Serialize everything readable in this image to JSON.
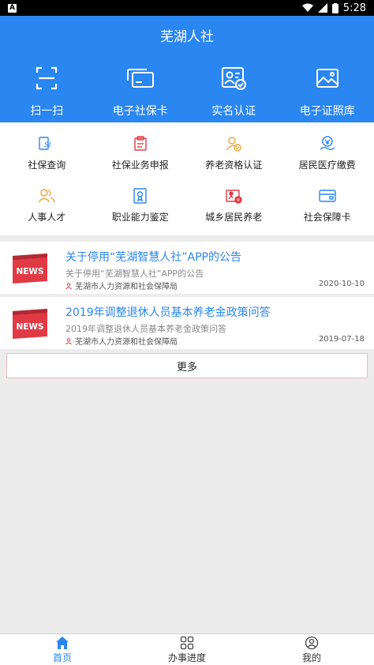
{
  "status_bar": {
    "time": "5:28",
    "notification_letter": "A"
  },
  "header": {
    "title": "芜湖人社",
    "quick_actions": [
      {
        "label": "扫一扫",
        "icon": "scan-icon"
      },
      {
        "label": "电子社保卡",
        "icon": "social-card-icon"
      },
      {
        "label": "实名认证",
        "icon": "id-verify-icon"
      },
      {
        "label": "电子证照库",
        "icon": "photo-license-icon"
      }
    ]
  },
  "services": [
    {
      "label": "社保查询",
      "icon": "si-query-icon"
    },
    {
      "label": "社保业务申报",
      "icon": "business-declare-icon"
    },
    {
      "label": "养老资格认证",
      "icon": "pension-cert-icon"
    },
    {
      "label": "居民医疗缴费",
      "icon": "medical-payment-icon"
    },
    {
      "label": "人事人才",
      "icon": "personnel-icon"
    },
    {
      "label": "职业能力鉴定",
      "icon": "vocational-icon"
    },
    {
      "label": "城乡居民养老",
      "icon": "rural-pension-icon"
    },
    {
      "label": "社会保障卡",
      "icon": "security-card-icon"
    }
  ],
  "news": [
    {
      "badge": "NEWS",
      "title": "关于停用“芜湖智慧人社”APP的公告",
      "summary": "关于停用“芜湖智慧人社”APP的公告",
      "source": "芜湖市人力资源和社会保障局",
      "date": "2020-10-10"
    },
    {
      "badge": "NEWS",
      "title": "2019年调整退休人员基本养老金政策问答",
      "summary": "2019年调整退休人员基本养老金政策问答",
      "source": "芜湖市人力资源和社会保障局",
      "date": "2019-07-18"
    }
  ],
  "more_label": "更多",
  "tabs": [
    {
      "label": "首页",
      "icon": "home-icon",
      "active": true
    },
    {
      "label": "办事进度",
      "icon": "grid-icon",
      "active": false
    },
    {
      "label": "我的",
      "icon": "user-icon",
      "active": false
    }
  ],
  "colors": {
    "primary": "#2a86f0",
    "news_red": "#e03a45",
    "icon_orange": "#f0a53c"
  }
}
